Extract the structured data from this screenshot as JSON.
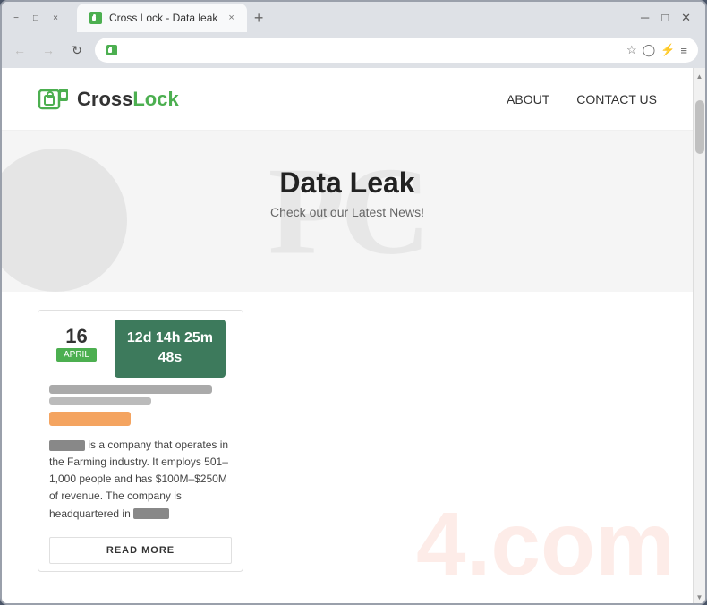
{
  "browser": {
    "tab_title": "Cross Lock - Data leak",
    "tab_favicon": "🔒",
    "new_tab_label": "+",
    "close_btn": "×",
    "minimize_btn": "−",
    "maximize_btn": "□",
    "address_url": "",
    "nav_back": "←",
    "nav_forward": "→",
    "nav_reload": "↻",
    "nav_home": "⊙"
  },
  "site": {
    "logo_text_cross": "Cross",
    "logo_text_lock": "Lock",
    "nav_about": "ABOUT",
    "nav_contact": "CONTACT US"
  },
  "hero": {
    "title": "Data Leak",
    "subtitle": "Check out our Latest News!",
    "watermark": "PC"
  },
  "card": {
    "date_number": "16",
    "date_month": "APRIL",
    "countdown": "12d 14h 25m\n48s",
    "description_start": "is a company that operates in the Farming industry. It employs 501–1,000 people and has $100M–$250M of revenue. The company is headquartered in",
    "read_more": "READ MORE"
  }
}
